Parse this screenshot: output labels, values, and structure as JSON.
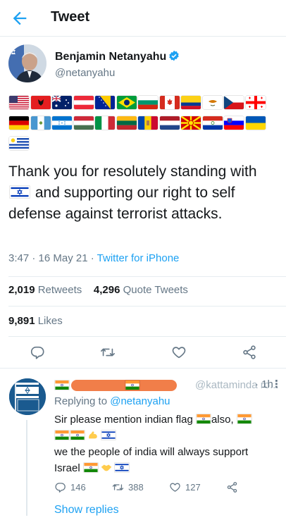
{
  "header": {
    "title": "Tweet",
    "back_icon": "back-arrow-icon"
  },
  "tweet": {
    "author": {
      "name": "Benjamin Netanyahu",
      "handle": "@netanyahu",
      "verified": true
    },
    "flags": [
      [
        "us",
        "al",
        "au",
        "at",
        "ba",
        "br",
        "bg",
        "ca",
        "co",
        "cy",
        "cz",
        "ge"
      ],
      [
        "de",
        "gt",
        "hn",
        "hu",
        "it",
        "lt",
        "md",
        "nl",
        "mk",
        "py",
        "si",
        "ua"
      ],
      [
        "uy"
      ]
    ],
    "text": {
      "part1": "Thank you for resolutely standing with",
      "inline_flag": "il",
      "part2": "and supporting our right to self defense against terrorist attacks."
    },
    "time": "3:47",
    "date": "16 May 21",
    "separator": "·",
    "client": "Twitter for iPhone",
    "stats": {
      "retweets": "2,019",
      "retweets_label": "Retweets",
      "quotes": "4,296",
      "quotes_label": "Quote Tweets",
      "likes": "9,891",
      "likes_label": "Likes"
    },
    "actions": [
      "reply-icon",
      "retweet-icon",
      "like-icon",
      "share-icon"
    ]
  },
  "reply": {
    "avatar_text": "I STAND WITH ISRAEL",
    "handle_partial": "@kattaminda ro...",
    "time": "· 1h",
    "more": "⋮",
    "replying_prefix": "Replying to",
    "replying_to": "@netanyahu",
    "body": {
      "line1": "Sir please mention indian flag",
      "line1_suffix": "also,",
      "line3": "we the people of india will always support",
      "line4": "Israel"
    },
    "counts": {
      "replies": "146",
      "retweets": "388",
      "likes": "127"
    },
    "show_replies": "Show replies"
  },
  "colors": {
    "accent": "#1da1f2",
    "text": "#14171a",
    "muted": "#657786",
    "redaction": "#f0773f"
  }
}
